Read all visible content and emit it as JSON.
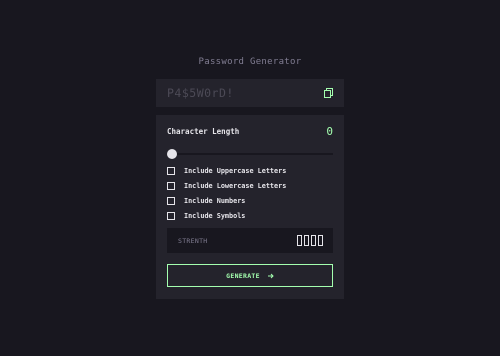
{
  "app": {
    "title": "Password Generator"
  },
  "password": {
    "value": "P4$5W0rD!",
    "copy_icon": "copy-icon"
  },
  "length": {
    "label": "Character Length",
    "value": "0",
    "slider_fraction": 0
  },
  "options": [
    {
      "label": "Include Uppercase Letters",
      "checked": false
    },
    {
      "label": "Include Lowercase Letters",
      "checked": false
    },
    {
      "label": "Include Numbers",
      "checked": false
    },
    {
      "label": "Include Symbols",
      "checked": false
    }
  ],
  "strength": {
    "label": "STRENTH",
    "bars_filled": 0,
    "bars_total": 4
  },
  "generate": {
    "label": "GENERATE",
    "icon": "arrow-right-icon"
  },
  "colors": {
    "background": "#18171f",
    "panel": "#24232c",
    "accent": "#a4ffaf",
    "text": "#e6e5ea",
    "muted": "#817d92",
    "placeholder": "#4c4a56"
  }
}
